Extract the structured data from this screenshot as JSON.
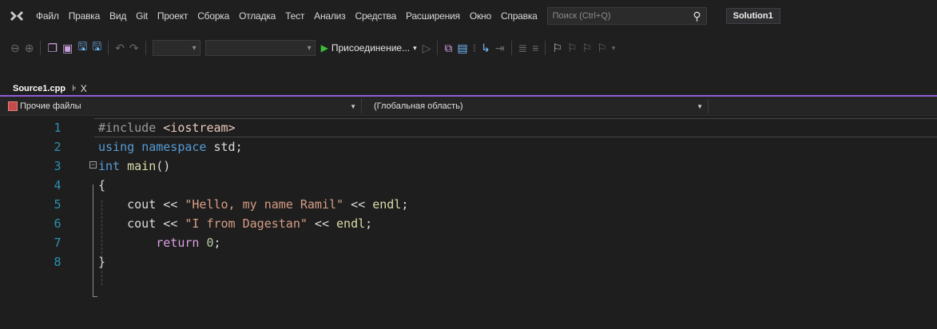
{
  "menu": {
    "items": [
      "Файл",
      "Правка",
      "Вид",
      "Git",
      "Проект",
      "Сборка",
      "Отладка",
      "Тест",
      "Анализ",
      "Средства",
      "Расширения",
      "Окно",
      "Справка"
    ],
    "search_placeholder": "Поиск (Ctrl+Q)",
    "solution_name": "Solution1"
  },
  "toolbar": {
    "attach_label": "Присоединение..."
  },
  "tab": {
    "filename": "Source1.cpp",
    "pin_glyph": "⊧",
    "close_glyph": "X"
  },
  "navigation": {
    "project": "Прочие файлы",
    "scope": "(Глобальная область)"
  },
  "editor": {
    "lines": [
      {
        "num": "1",
        "tokens": [
          [
            "m",
            "#include "
          ],
          [
            "inc",
            "<iostream>"
          ]
        ]
      },
      {
        "num": "2",
        "tokens": [
          [
            "k",
            "using "
          ],
          [
            "k",
            "namespace "
          ],
          [
            "n",
            "std;"
          ]
        ]
      },
      {
        "num": "3",
        "tokens": [
          [
            "k",
            "int "
          ],
          [
            "f",
            "main"
          ],
          [
            "n",
            "()"
          ]
        ]
      },
      {
        "num": "4",
        "tokens": [
          [
            "n",
            "{"
          ]
        ]
      },
      {
        "num": "5",
        "tokens": [
          [
            "n",
            "    cout << "
          ],
          [
            "s",
            "\"Hello, my name Ramil\""
          ],
          [
            "n",
            " << "
          ],
          [
            "f",
            "endl"
          ],
          [
            "n",
            ";"
          ]
        ]
      },
      {
        "num": "6",
        "tokens": [
          [
            "n",
            "    cout << "
          ],
          [
            "s",
            "\"I from Dagestan\""
          ],
          [
            "n",
            " << "
          ],
          [
            "f",
            "endl"
          ],
          [
            "n",
            ";"
          ]
        ]
      },
      {
        "num": "7",
        "tokens": [
          [
            "n",
            "        "
          ],
          [
            "ctl",
            "return "
          ],
          [
            "num",
            "0"
          ],
          [
            "n",
            ";"
          ]
        ]
      },
      {
        "num": "8",
        "tokens": [
          [
            "n",
            "}"
          ]
        ]
      }
    ]
  },
  "colors": {
    "accent": "#8f5bd6",
    "line_number": "#2b91af",
    "keyword": "#569cd6",
    "string": "#d69d85",
    "function": "#dcdcaa",
    "control": "#d8a0df"
  }
}
